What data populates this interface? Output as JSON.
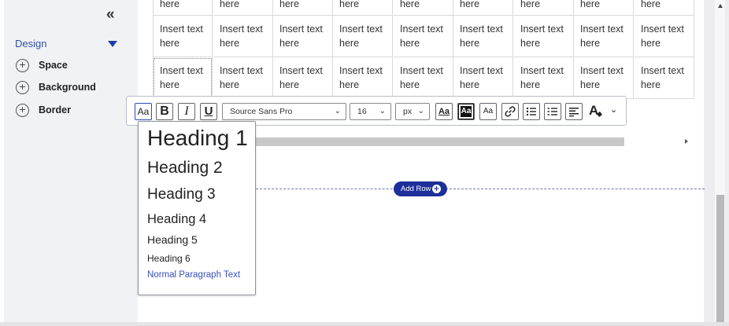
{
  "sidebar": {
    "collapse_glyph": "«",
    "section_title": "Design",
    "items": [
      {
        "label": "Space"
      },
      {
        "label": "Background"
      },
      {
        "label": "Border"
      }
    ]
  },
  "table": {
    "row0_cells": [
      "here",
      "here",
      "here",
      "here",
      "here",
      "here",
      "here",
      "here",
      "here"
    ],
    "row1_cells": [
      "Insert text here",
      "Insert text here",
      "Insert text here",
      "Insert text here",
      "Insert text here",
      "Insert text here",
      "Insert text here",
      "Insert text here",
      "Insert text here"
    ],
    "row2_cells": [
      "Insert text here",
      "Insert text here",
      "Insert text here",
      "Insert text here",
      "Insert text here",
      "Insert text here",
      "Insert text here",
      "Insert text here",
      "Insert text here"
    ]
  },
  "toolbar": {
    "heading_btn": "Aa",
    "bold_btn": "B",
    "italic_btn": "I",
    "underline_btn": "U",
    "font_family": "Source Sans Pro",
    "font_size": "16",
    "font_unit": "px",
    "text_case_btn": "Aa",
    "highlight_btn": "Aa",
    "text_box_btn": "Aa",
    "font_color_btn": "A",
    "chevron": "⌄",
    "more_chevron": "⌄"
  },
  "heading_menu": {
    "h1": "Heading 1",
    "h2": "Heading 2",
    "h3": "Heading 3",
    "h4": "Heading 4",
    "h5": "Heading 5",
    "h6": "Heading 6",
    "paragraph": "Normal Paragraph Text"
  },
  "add_row": {
    "label": "Add Row",
    "plus": "+"
  },
  "icons": {
    "plus_glyph": "+"
  },
  "colors": {
    "accent": "#1d2f9a",
    "link": "#3850b8",
    "sidebar_bg": "#f1f2f4"
  }
}
